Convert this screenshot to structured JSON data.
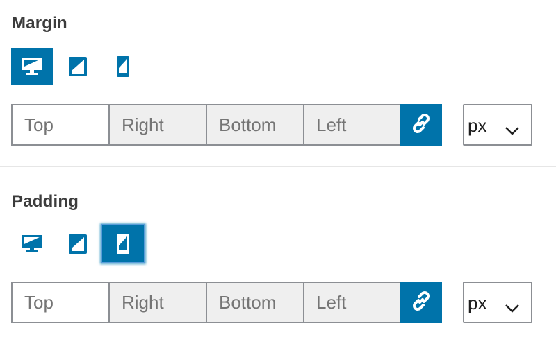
{
  "margin": {
    "title": "Margin",
    "devices": {
      "active": "desktop"
    },
    "fields": {
      "top": "Top",
      "right": "Right",
      "bottom": "Bottom",
      "left": "Left"
    },
    "unit": "px"
  },
  "padding": {
    "title": "Padding",
    "devices": {
      "active": "mobile"
    },
    "fields": {
      "top": "Top",
      "right": "Right",
      "bottom": "Bottom",
      "left": "Left"
    },
    "unit": "px"
  },
  "colors": {
    "accent": "#0073aa",
    "border": "#8c8f94",
    "placeholder": "#757575",
    "field_bg": "#efefef"
  },
  "icons": {
    "desktop": "desktop-icon",
    "tablet": "tablet-icon",
    "mobile": "mobile-icon",
    "link": "link-icon",
    "chevron": "chevron-down-icon"
  }
}
